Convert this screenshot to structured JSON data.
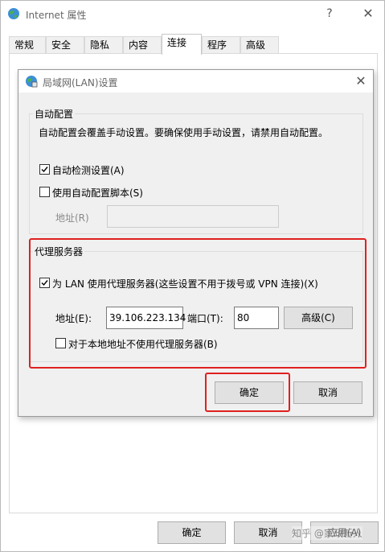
{
  "window": {
    "title": "Internet 属性",
    "help_label": "?",
    "close_label": "✕"
  },
  "tabs": [
    {
      "label": "常规",
      "active": false
    },
    {
      "label": "安全",
      "active": false
    },
    {
      "label": "隐私",
      "active": false
    },
    {
      "label": "内容",
      "active": false
    },
    {
      "label": "连接",
      "active": true
    },
    {
      "label": "程序",
      "active": false
    },
    {
      "label": "高级",
      "active": false
    }
  ],
  "footer": {
    "ok_label": "确定",
    "cancel_label": "取消",
    "apply_label": "应用(A)"
  },
  "watermark": "知乎 @家政新人",
  "lan_dialog": {
    "title": "局域网(LAN)设置",
    "close_label": "✕",
    "auto_config": {
      "group_label": "自动配置",
      "description": "自动配置会覆盖手动设置。要确保使用手动设置，请禁用自动配置。",
      "auto_detect_label": "自动检测设置(A)",
      "auto_detect_checked": true,
      "use_script_label": "使用自动配置脚本(S)",
      "use_script_checked": false,
      "address_label": "地址(R)",
      "address_value": ""
    },
    "proxy": {
      "group_label": "代理服务器",
      "use_proxy_label": "为 LAN 使用代理服务器(这些设置不用于拨号或 VPN 连接)(X)",
      "use_proxy_checked": true,
      "address_label": "地址(E):",
      "address_value": "39.106.223.134",
      "port_label": "端口(T):",
      "port_value": "80",
      "advanced_label": "高级(C)",
      "bypass_local_label": "对于本地地址不使用代理服务器(B)",
      "bypass_local_checked": false
    },
    "ok_label": "确定",
    "cancel_label": "取消"
  },
  "colors": {
    "highlight": "#e02020",
    "dialog_bg": "#f0f0f0",
    "button_bg": "#e1e1e1"
  },
  "icons": {
    "app": "internet-globe-icon",
    "lan": "network-globe-icon",
    "check": "checkmark-icon"
  }
}
